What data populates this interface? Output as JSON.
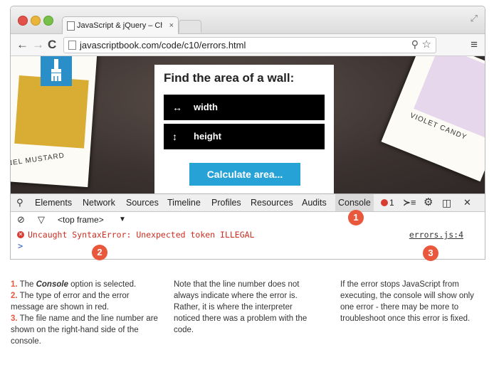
{
  "browser": {
    "tab_title": "JavaScript & jQuery – Chap",
    "tab_close": "×",
    "url": "javascriptbook.com/code/c10/errors.html"
  },
  "page": {
    "swatch_left_label": "ONEL MUSTARD",
    "swatch_right_label": "VIOLET CANDY",
    "card_title": "Find the area of a wall:",
    "width_label": "width",
    "height_label": "height",
    "calculate_label": "Calculate area..."
  },
  "devtools": {
    "tabs": [
      "Elements",
      "Network",
      "Sources",
      "Timeline",
      "Profiles",
      "Resources",
      "Audits",
      "Console"
    ],
    "active_tab": "Console",
    "error_count": "1",
    "frame_selector": "<top frame>",
    "error_message": "Uncaught SyntaxError: Unexpected token ILLEGAL",
    "error_location": "errors.js:4",
    "prompt": ">"
  },
  "callouts": [
    "1",
    "2",
    "3"
  ],
  "captions": {
    "col1": {
      "item1_num": "1.",
      "item1_pre": " The ",
      "item1_em": "Console",
      "item1_post": " option is selected.",
      "item2_num": "2.",
      "item2_text": " The type of error and the error message are shown in red.",
      "item3_num": "3.",
      "item3_text": " The file name and the line number are shown on the right-hand side of the console."
    },
    "col2": "Note that the line number does not always  indicate where the error is. Rather, it is where the interpreter noticed there was a problem with the code.",
    "col3": "If the error stops JavaScript from executing, the console will show only one error - there may be more to troubleshoot once this error is fixed."
  },
  "colors": {
    "accent": "#e9583c",
    "error_red": "#cc2d20",
    "calc_button": "#27a2d6",
    "brush_badge": "#2a8fc9",
    "mustard": "#d9ac33",
    "violet": "#e7d7ec"
  }
}
